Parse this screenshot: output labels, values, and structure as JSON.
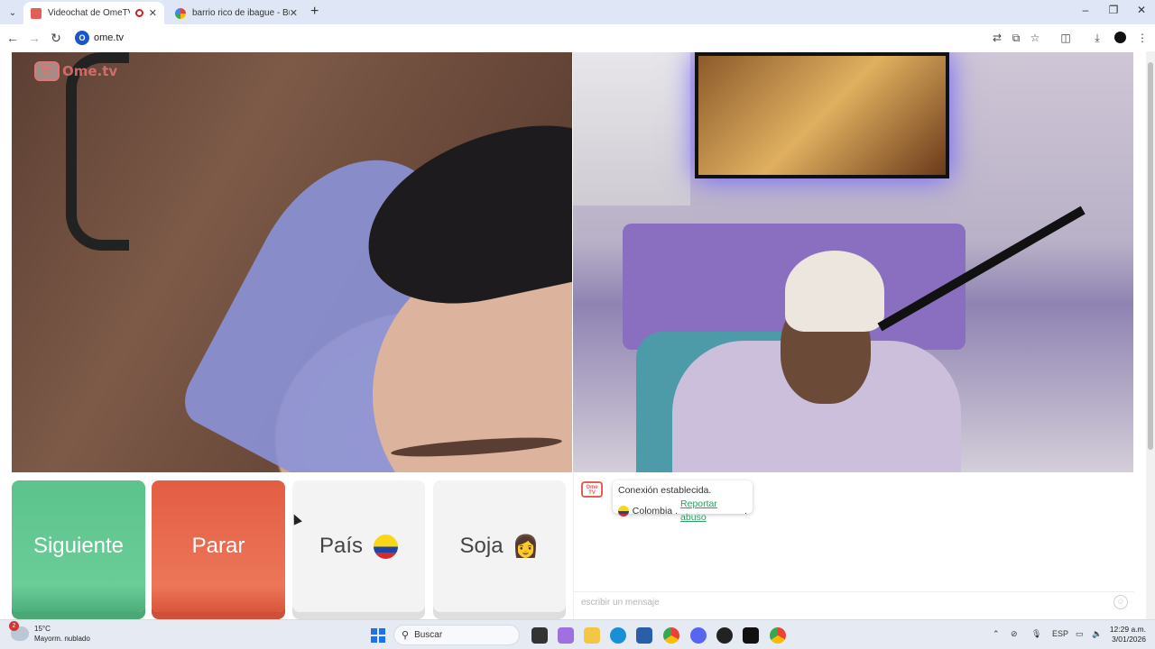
{
  "browser": {
    "tabs": [
      {
        "title": "Videochat de OmeTV: una",
        "active": true
      },
      {
        "title": "barrio rico de ibague - Buscar c",
        "active": false
      }
    ],
    "new_tab": "+",
    "url": "ome.tv",
    "site_icon": "O",
    "window_controls": {
      "minimize": "–",
      "maximize": "❐",
      "close": "✕"
    }
  },
  "logo": {
    "badge": "Ome TV",
    "text": "Ome.tv"
  },
  "controls": {
    "next_label": "Siguiente",
    "stop_label": "Parar",
    "country_label": "País",
    "gender_label": "Soja",
    "gender_emoji": "👩"
  },
  "chat": {
    "logo": "Ome TV",
    "message_line1": "Conexión establecida.",
    "country": "Colombia",
    "country_suffix": ".",
    "report_link": "Reportar abuso",
    "report_suffix": ".",
    "input_placeholder": "escribir un mensaje"
  },
  "taskbar": {
    "weather_badge": "2",
    "temperature": "15°C",
    "weather_desc": "Mayorm. nublado",
    "search_label": "Buscar",
    "language": "ESP",
    "time": "12:29 a.m.",
    "date": "3/01/2026"
  },
  "colors": {
    "next": "#5cc38c",
    "stop": "#e35d43",
    "accent_link": "#2a9d62",
    "logo": "#e57373"
  },
  "icons": [
    "chevron-down-icon",
    "record-icon",
    "close-icon",
    "back-icon",
    "forward-icon",
    "reload-icon",
    "translate-icon",
    "install-icon",
    "star-icon",
    "extensions-icon",
    "download-icon",
    "menu-icon",
    "emoji-icon",
    "windows-icon",
    "search-icon"
  ]
}
